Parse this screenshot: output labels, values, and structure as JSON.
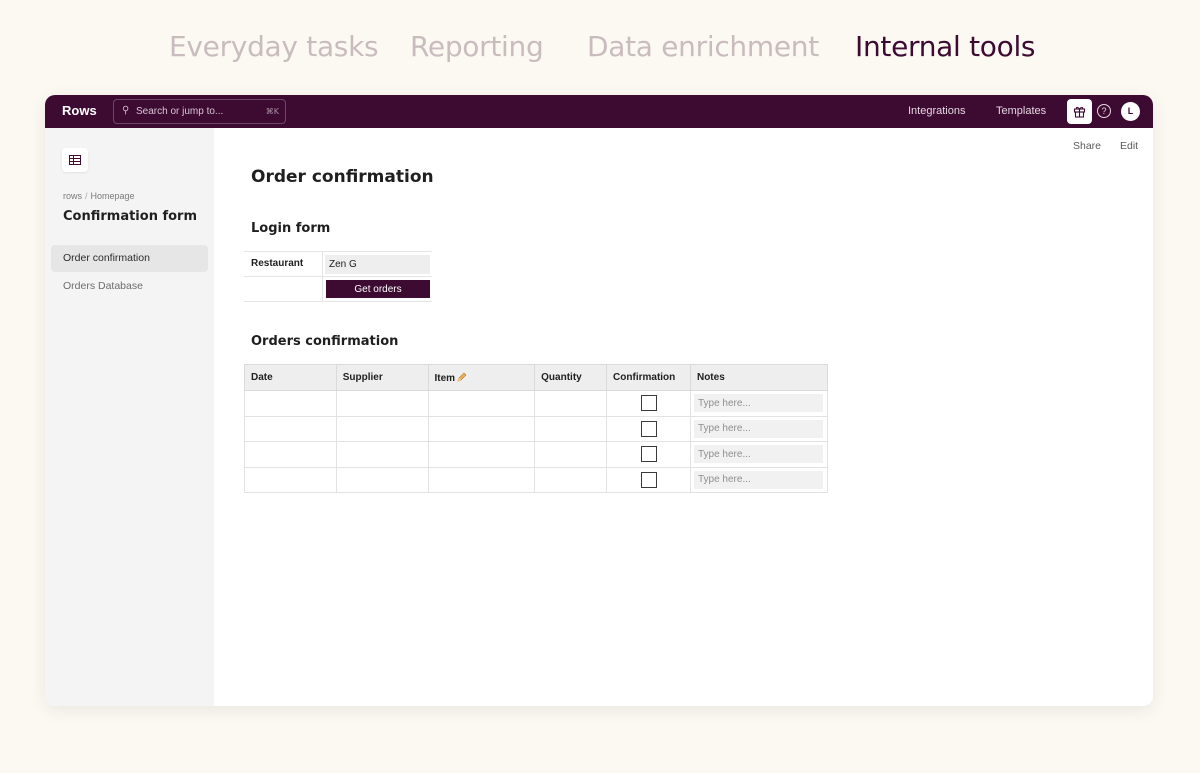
{
  "hero_tabs": [
    {
      "label": "Everyday tasks",
      "active": false
    },
    {
      "label": "Reporting",
      "active": false
    },
    {
      "label": "Data enrichment",
      "active": false
    },
    {
      "label": "Internal tools",
      "active": true
    }
  ],
  "topbar": {
    "brand": "Rows",
    "search": {
      "placeholder": "Search or jump to...",
      "shortcut": "⌘K"
    },
    "links": [
      "Integrations",
      "Templates"
    ],
    "avatar_initial": "L"
  },
  "sidebar": {
    "breadcrumb": [
      "rows",
      "Homepage"
    ],
    "title": "Confirmation form",
    "items": [
      {
        "label": "Order confirmation",
        "active": true
      },
      {
        "label": "Orders Database",
        "active": false
      }
    ]
  },
  "main": {
    "actions": [
      "Share",
      "Edit"
    ],
    "title": "Order confirmation",
    "login_form": {
      "title": "Login form",
      "restaurant_label": "Restaurant",
      "restaurant_value": "Zen G",
      "button_label": "Get orders"
    },
    "orders": {
      "title": "Orders confirmation",
      "columns": [
        "Date",
        "Supplier",
        "Item",
        "Quantity",
        "Confirmation",
        "Notes"
      ],
      "note_placeholder": "Type here...",
      "row_count": 4
    }
  },
  "colors": {
    "brand": "#3d0b32",
    "hero_inactive": "#c9bcbf",
    "background": "#fcf9f2"
  }
}
